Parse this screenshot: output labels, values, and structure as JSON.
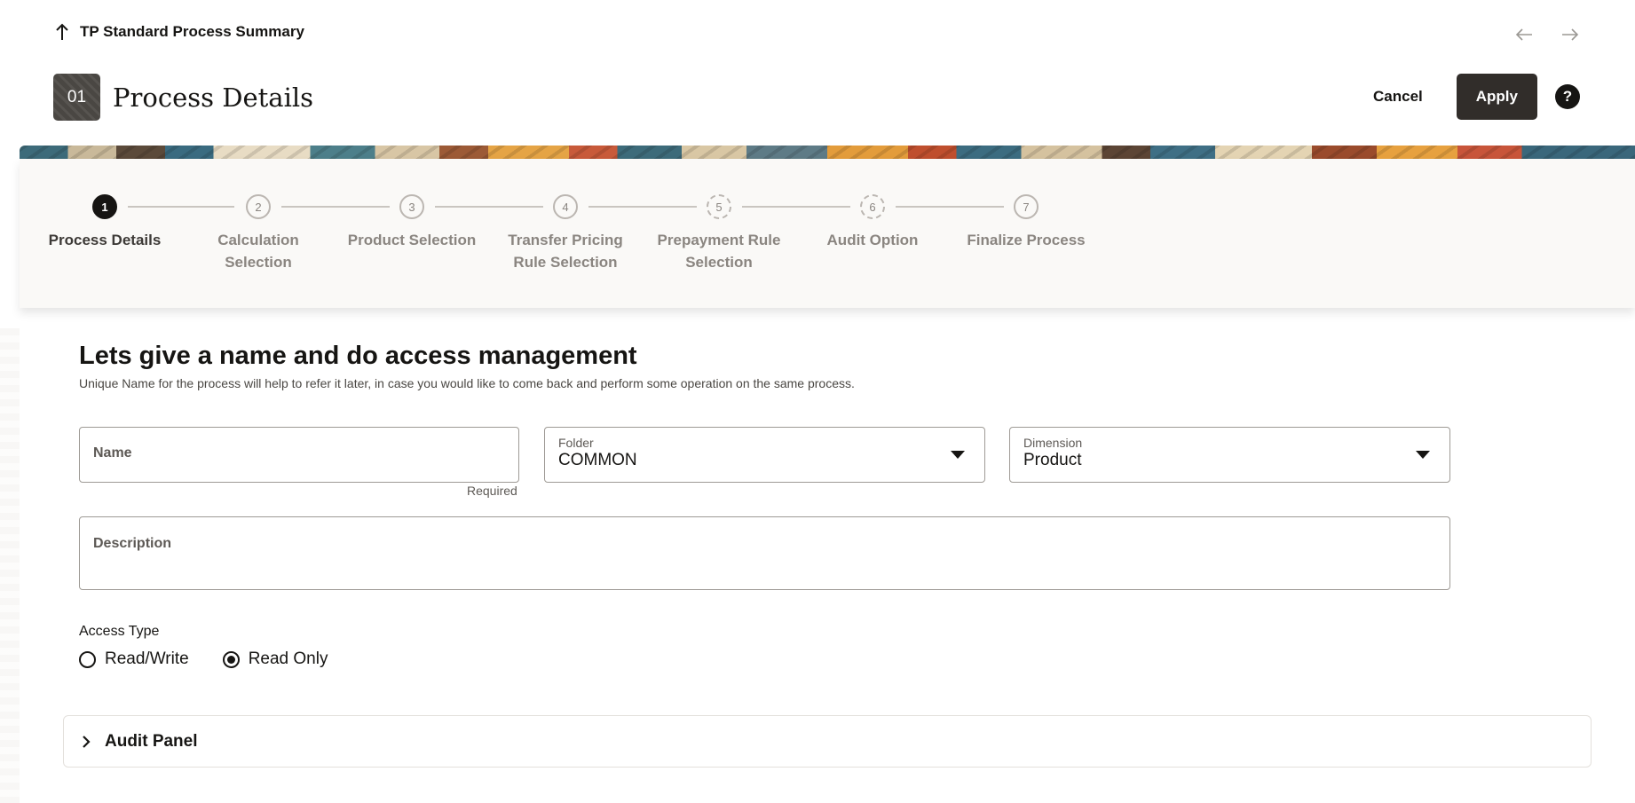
{
  "breadcrumb": {
    "label": "TP Standard Process Summary"
  },
  "header": {
    "badge": "01",
    "title": "Process Details",
    "cancel_label": "Cancel",
    "apply_label": "Apply",
    "help_label": "?"
  },
  "steps": [
    {
      "number": "1",
      "label_line1": "Process Details",
      "label_line2": "",
      "state": "active"
    },
    {
      "number": "2",
      "label_line1": "Calculation",
      "label_line2": "Selection",
      "state": "pending"
    },
    {
      "number": "3",
      "label_line1": "Product Selection",
      "label_line2": "",
      "state": "pending"
    },
    {
      "number": "4",
      "label_line1": "Transfer Pricing",
      "label_line2": "Rule Selection",
      "state": "pending"
    },
    {
      "number": "5",
      "label_line1": "Prepayment Rule",
      "label_line2": "Selection",
      "state": "disabled"
    },
    {
      "number": "6",
      "label_line1": "Audit Option",
      "label_line2": "",
      "state": "disabled"
    },
    {
      "number": "7",
      "label_line1": "Finalize Process",
      "label_line2": "",
      "state": "pending"
    }
  ],
  "main": {
    "title": "Lets give a name and do access management",
    "subtitle": "Unique Name for the process will help to refer it later, in case you would like to come back and perform some operation on the same process."
  },
  "form": {
    "name": {
      "label": "Name",
      "value": "",
      "helper": "Required"
    },
    "folder": {
      "label": "Folder",
      "value": "COMMON"
    },
    "dimension": {
      "label": "Dimension",
      "value": "Product"
    },
    "description": {
      "label": "Description",
      "value": ""
    },
    "access_type": {
      "label": "Access Type",
      "options": [
        "Read/Write",
        "Read Only"
      ],
      "selected": "Read Only"
    }
  },
  "audit_panel": {
    "label": "Audit Panel",
    "expanded": false
  },
  "icons": {
    "back": "arrow-up-icon",
    "prev": "arrow-left-icon",
    "next": "arrow-right-icon",
    "help": "help-icon",
    "dropdown": "caret-down-icon",
    "expand": "chevron-right-icon"
  },
  "colors": {
    "primary_button": "#312d2a",
    "text": "#161513",
    "train_background": "#faf9f7",
    "muted_text": "#8a8580"
  }
}
